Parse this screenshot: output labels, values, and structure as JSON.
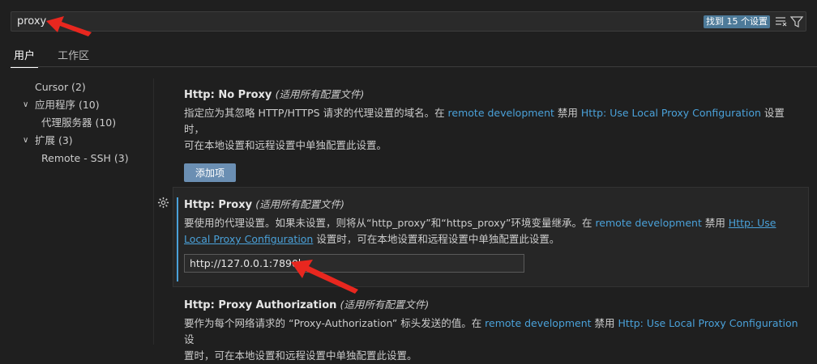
{
  "search": {
    "value": "proxy",
    "result_count_label": "找到 15 个设置"
  },
  "tabs": [
    {
      "label": "用户"
    },
    {
      "label": "工作区"
    }
  ],
  "toc": {
    "items": [
      {
        "label": "Cursor (2)"
      },
      {
        "label": "应用程序 (10)"
      },
      {
        "label": "代理服务器 (10)"
      },
      {
        "label": "扩展 (3)"
      },
      {
        "label": "Remote - SSH (3)"
      }
    ]
  },
  "settings": {
    "no_proxy": {
      "category": "Http: ",
      "name": "No Proxy",
      "scope": "(适用所有配置文件)",
      "desc_1": "指定应为其忽略 HTTP/HTTPS 请求的代理设置的域名。在 ",
      "link_1": "remote development",
      "desc_2": " 禁用 ",
      "link_2": "Http: Use Local Proxy Configuration",
      "desc_3": " 设置时，",
      "desc_line2": "可在本地设置和远程设置中单独配置此设置。",
      "add_button": "添加项"
    },
    "proxy": {
      "category": "Http: ",
      "name": "Proxy",
      "scope": "(适用所有配置文件)",
      "desc_1": "要使用的代理设置。如果未设置，则将从“http_proxy”和“https_proxy”环境变量继承。在 ",
      "link_1": "remote development",
      "desc_2": " 禁用 ",
      "link_2a": "Http: Use",
      "link_2b": "Local Proxy Configuration",
      "desc_3": " 设置时，可在本地设置和远程设置中单独配置此设置。",
      "value": "http://127.0.0.1:7890"
    },
    "proxy_auth": {
      "category": "Http: ",
      "name": "Proxy Authorization",
      "scope": "(适用所有配置文件)",
      "desc_1": "要作为每个网络请求的 “Proxy-Authorization” 标头发送的值。在 ",
      "link_1": "remote development",
      "desc_2": " 禁用 ",
      "link_2": "Http: Use Local Proxy Configuration",
      "desc_3": " 设",
      "desc_line2": "置时，可在本地设置和远程设置中单独配置此设置。"
    }
  },
  "colors": {
    "accent": "#4aa1d9",
    "arrow": "#e8271f",
    "badge": "#4d7a99",
    "button": "#6b8fb3"
  }
}
